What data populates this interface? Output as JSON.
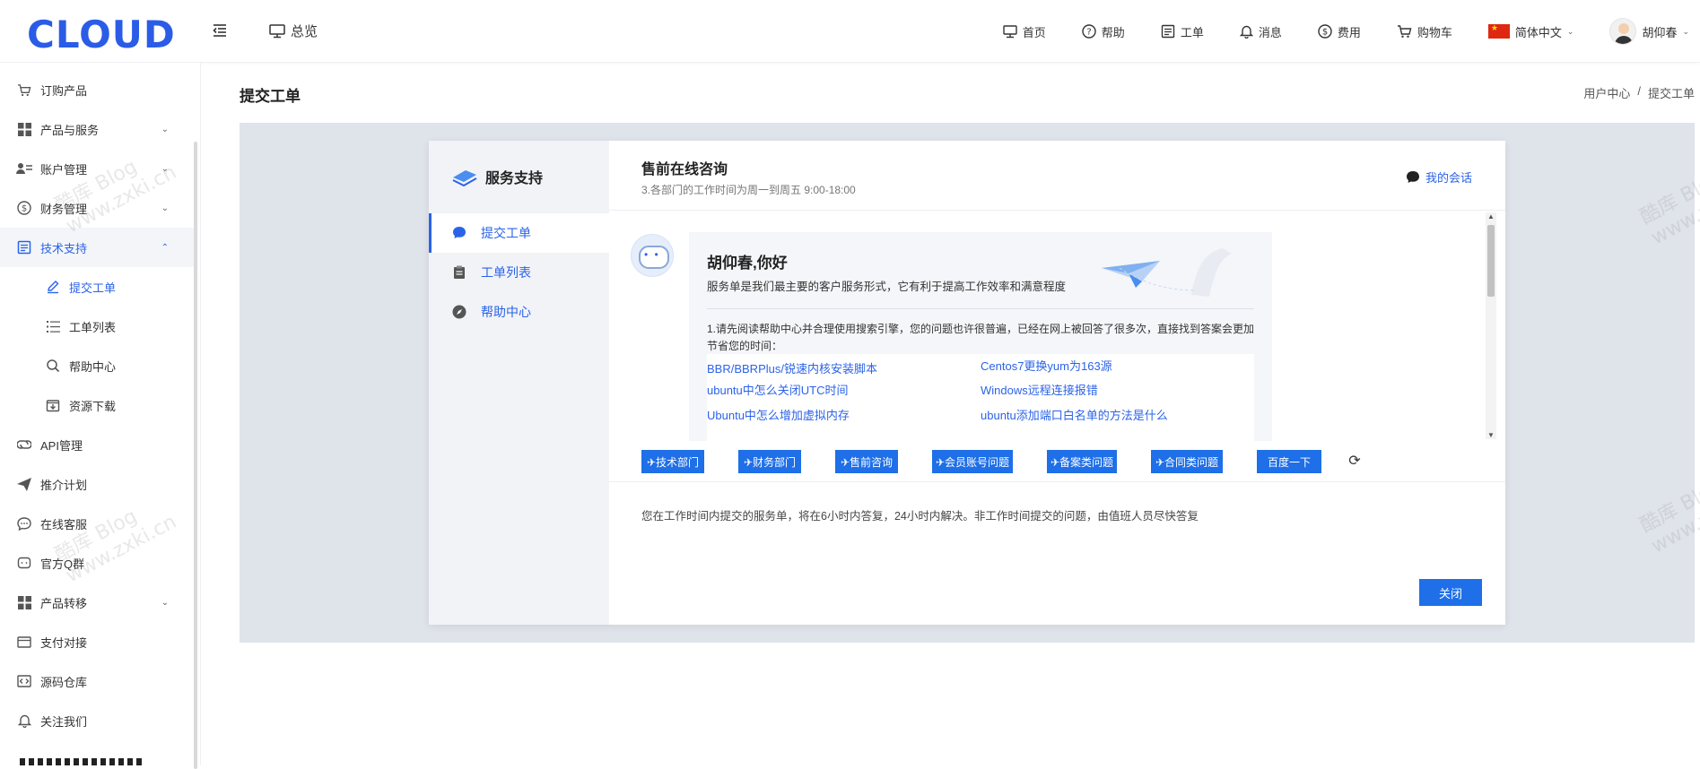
{
  "header": {
    "logo": "CLOUD",
    "overview": "总览",
    "nav": [
      {
        "label": "首页",
        "icon": "monitor-icon"
      },
      {
        "label": "帮助",
        "icon": "help-icon"
      },
      {
        "label": "工单",
        "icon": "ticket-icon"
      },
      {
        "label": "消息",
        "icon": "bell-icon"
      },
      {
        "label": "费用",
        "icon": "dollar-icon"
      },
      {
        "label": "购物车",
        "icon": "cart-icon"
      }
    ],
    "language": "简体中文",
    "user": "胡仰春"
  },
  "sidebar": {
    "items": [
      {
        "label": "订购产品"
      },
      {
        "label": "产品与服务"
      },
      {
        "label": "账户管理"
      },
      {
        "label": "财务管理"
      },
      {
        "label": "技术支持"
      },
      {
        "label": "提交工单"
      },
      {
        "label": "工单列表"
      },
      {
        "label": "帮助中心"
      },
      {
        "label": "资源下载"
      },
      {
        "label": "API管理"
      },
      {
        "label": "推介计划"
      },
      {
        "label": "在线客服"
      },
      {
        "label": "官方Q群"
      },
      {
        "label": "产品转移"
      },
      {
        "label": "支付对接"
      },
      {
        "label": "源码仓库"
      },
      {
        "label": "关注我们"
      }
    ]
  },
  "page": {
    "title": "提交工单",
    "breadcrumb": [
      "用户中心",
      "/",
      "提交工单"
    ]
  },
  "modal": {
    "left_title": "服务支持",
    "nav": [
      {
        "label": "提交工单"
      },
      {
        "label": "工单列表"
      },
      {
        "label": "帮助中心"
      }
    ],
    "chat_title": "售前在线咨询",
    "chat_subtitle": "3.各部门的工作时间为周一到周五 9:00-18:00",
    "my_sessions": "我的会话",
    "hello": "胡仰春,你好",
    "desc": "服务单是我们最主要的客户服务形式，它有利于提高工作效率和满意程度",
    "tip": "1.请先阅读帮助中心并合理使用搜索引擎，您的问题也许很普遍，已经在网上被回答了很多次，直接找到答案会更加节省您的时间：",
    "links": [
      "BBR/BBRPlus/锐速内核安装脚本",
      "Centos7更换yum为163源",
      "ubuntu中怎么关闭UTC时间",
      "Windows远程连接报错",
      "Ubuntu中怎么增加虚拟内存",
      "ubuntu添加端口白名单的方法是什么"
    ],
    "quick_buttons": [
      "✈技术部门",
      "✈财务部门",
      "✈售前咨询",
      "✈会员账号问题",
      "✈备案类问题",
      "✈合同类问题",
      "百度一下"
    ],
    "notice": "您在工作时间内提交的服务单，将在6小时内答复，24小时内解决。非工作时间提交的问题，由值班人员尽快答复",
    "close": "关闭"
  },
  "watermark": {
    "line1": "酷库 Blog",
    "line2": "www.zxki.cn"
  },
  "colors": {
    "accent": "#2b63e8",
    "button": "#1e6fe8",
    "content_bg": "#dfe3ea"
  }
}
